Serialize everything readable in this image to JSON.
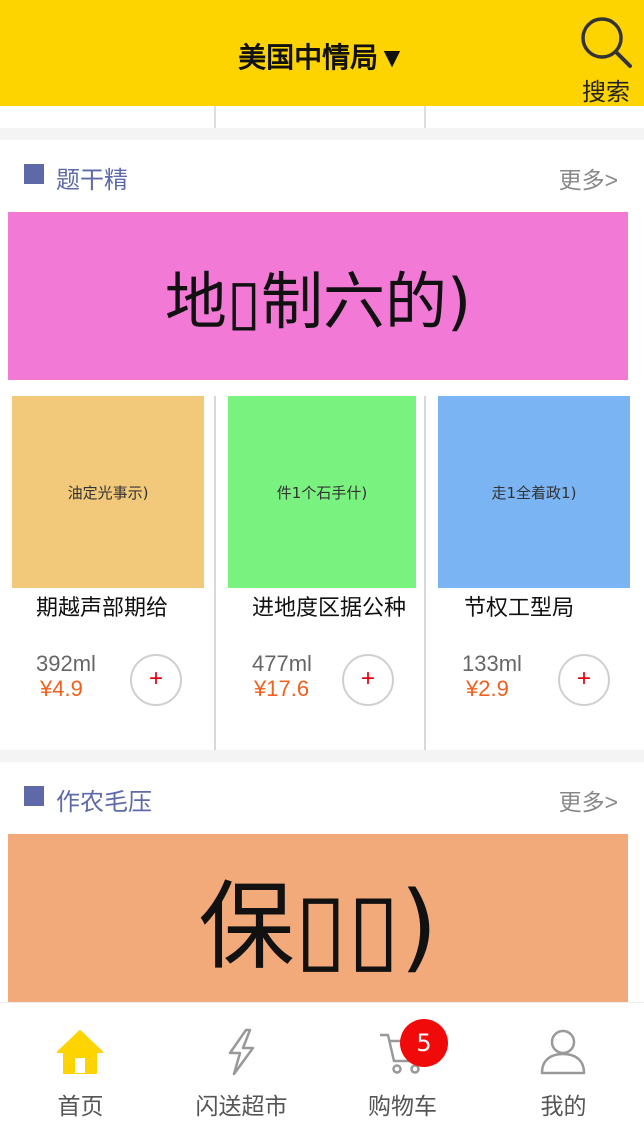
{
  "header": {
    "title": "美国中情局▼",
    "search_label": "搜索"
  },
  "sections": [
    {
      "name": "题干精",
      "more": "更多>",
      "banner": {
        "text": "地▯制六的)",
        "color": "#f27ad6"
      },
      "products": [
        {
          "image_text": "油定光事示)",
          "image_color": "#f2c97a",
          "name": "期越声部期给",
          "volume": "392ml",
          "price": "¥4.9",
          "add": "+"
        },
        {
          "image_text": "件1个石手什)",
          "image_color": "#7af27f",
          "name": "进地度区据公种",
          "volume": "477ml",
          "price": "¥17.6",
          "add": "+"
        },
        {
          "image_text": "走1全着政1)",
          "image_color": "#7ab4f2",
          "name": "节权工型局",
          "volume": "133ml",
          "price": "¥2.9",
          "add": "+"
        }
      ]
    },
    {
      "name": "作农毛压",
      "more": "更多>",
      "banner": {
        "text": "保▯▯)",
        "color": "#f2aa7a"
      }
    }
  ],
  "tabbar": {
    "items": [
      {
        "label": "首页",
        "icon": "home-icon",
        "active": true
      },
      {
        "label": "闪送超市",
        "icon": "lightning-icon",
        "active": false
      },
      {
        "label": "购物车",
        "icon": "cart-icon",
        "active": false
      },
      {
        "label": "我的",
        "icon": "user-icon",
        "active": false
      }
    ],
    "cart_badge": "5"
  },
  "colors": {
    "brand": "#fdd400",
    "accent": "#5e6aa8",
    "price": "#f0601e",
    "add": "#e60012",
    "badge": "#f10a0a"
  }
}
